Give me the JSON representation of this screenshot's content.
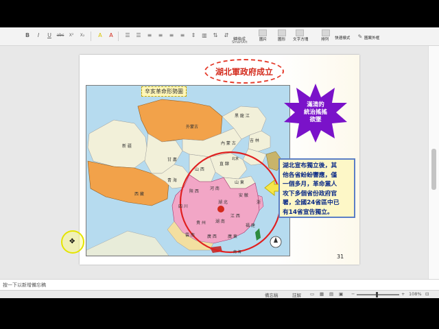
{
  "ribbon": {
    "format_buttons": [
      "B",
      "I",
      "U",
      "abc",
      "X²",
      "X₂",
      "A",
      "A"
    ],
    "smartart_line1": "轉換成",
    "smartart_line2": "SmartArt",
    "image_label": "圖片",
    "shape_label": "圖形",
    "textbox_label": "文字方塊",
    "arrange_label": "排列",
    "quick_style_label": "快速樣式",
    "shape_fill_label": "圖案外框"
  },
  "slide": {
    "title": "湖北軍政府成立",
    "map_tag": "辛亥革命形勢圖",
    "star_text": [
      "滿清的",
      "統治搖搖",
      "欲墜"
    ],
    "callout_lines": [
      "湖北宣布獨立後，其",
      "他各省紛紛響應，僅",
      "一個多月，革命黨人",
      "攻下多個省份政府官",
      "署，全國24省區中已",
      "有14省宣告獨立。"
    ],
    "slide_number": "31",
    "map_labels": {
      "xinjiang": "新 疆",
      "waimenggu": "外蒙古",
      "heilongjiang": "黑 龍 江",
      "jilin": "吉 林",
      "neimenggu": "內 蒙 古",
      "gansu": "甘 肅",
      "qinghai": "青 海",
      "xizang": "西 藏",
      "shanxi": "山 西",
      "shandong": "山 東",
      "henan": "河 南",
      "shaanxi": "陝 西",
      "sichuan": "四 川",
      "hubei": "湖 北",
      "hunan": "湖 南",
      "jiangxi": "江 西",
      "guizhou": "貴 州",
      "yunnan": "雲 南",
      "guangxi": "廣 西",
      "guangdong": "廣 東",
      "fujian": "福 建",
      "zhejiang": "浙",
      "anhui": "安 徽",
      "zhili": "直 隸",
      "beijing": "北京",
      "nanhai": "南 海"
    }
  },
  "notes": {
    "placeholder": "按一下以新增備忘稿"
  },
  "status": {
    "notes_toggle": "備忘稿",
    "comments_toggle": "註解",
    "zoom": "108%"
  },
  "colors": {
    "accent_red": "#d32a1c",
    "revolution_pink": "#f2a6c6",
    "callout_text": "#0b2a86",
    "star_purple": "#7a12c9"
  }
}
